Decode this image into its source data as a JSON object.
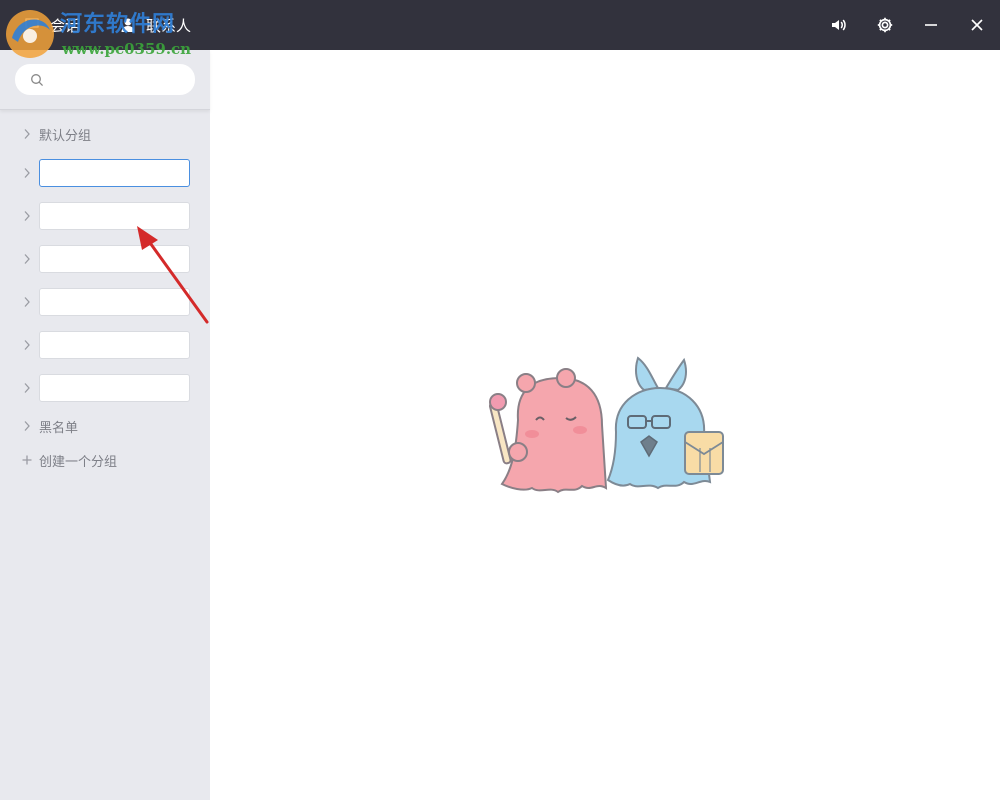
{
  "titlebar": {
    "tabs": [
      {
        "label": "会话",
        "icon": "chat-icon"
      },
      {
        "label": "联系人",
        "icon": "contacts-icon"
      }
    ],
    "controls": [
      "speaker-icon",
      "gear-icon",
      "minimize-icon",
      "close-icon"
    ],
    "bg_color": "#32323d"
  },
  "watermark": {
    "title": "河东软件网",
    "url": "www.pc0359.cn"
  },
  "sidebar": {
    "search": {
      "placeholder": "",
      "value": ""
    },
    "default_group": "默认分组",
    "new_group_inputs": [
      "",
      "",
      "",
      "",
      "",
      ""
    ],
    "blacklist": "黑名单",
    "create_group": "创建一个分组",
    "bg_color": "#e8e9ee"
  },
  "colors": {
    "annotation_arrow": "#d42a2a",
    "input_focus": "#4a8fe0"
  }
}
